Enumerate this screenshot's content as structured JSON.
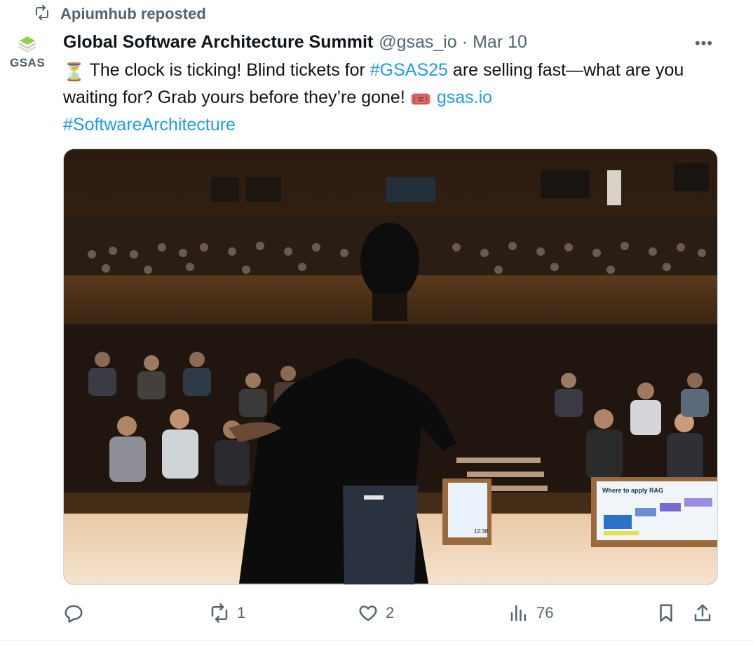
{
  "repost": {
    "label": "Apiumhub reposted",
    "icon": "repost-icon"
  },
  "author": {
    "avatar_text": "GSAS",
    "name": "Global Software Architecture Summit",
    "handle": "@gsas_io",
    "separator": "·",
    "date": "Mar 10"
  },
  "more_label": "•••",
  "tweet": {
    "hourglass": "⏳",
    "part1": " The clock is ticking! Blind tickets for ",
    "hashtag1": "#GSAS25",
    "part2": " are selling fast—what are you waiting for? Grab yours before they’re gone! ",
    "ticket_emoji": "🎟️",
    "link": "gsas.io",
    "hashtag2": "#SoftwareArchitecture"
  },
  "media": {
    "description_icon": "photo",
    "slide_title": "Where to apply RAG",
    "screen_clock": "12:38"
  },
  "actions": {
    "reply_count": "",
    "repost_count": "1",
    "like_count": "2",
    "views_count": "76"
  },
  "colors": {
    "link": "#1d9bf0",
    "muted": "#536471",
    "text": "#0f1419"
  }
}
